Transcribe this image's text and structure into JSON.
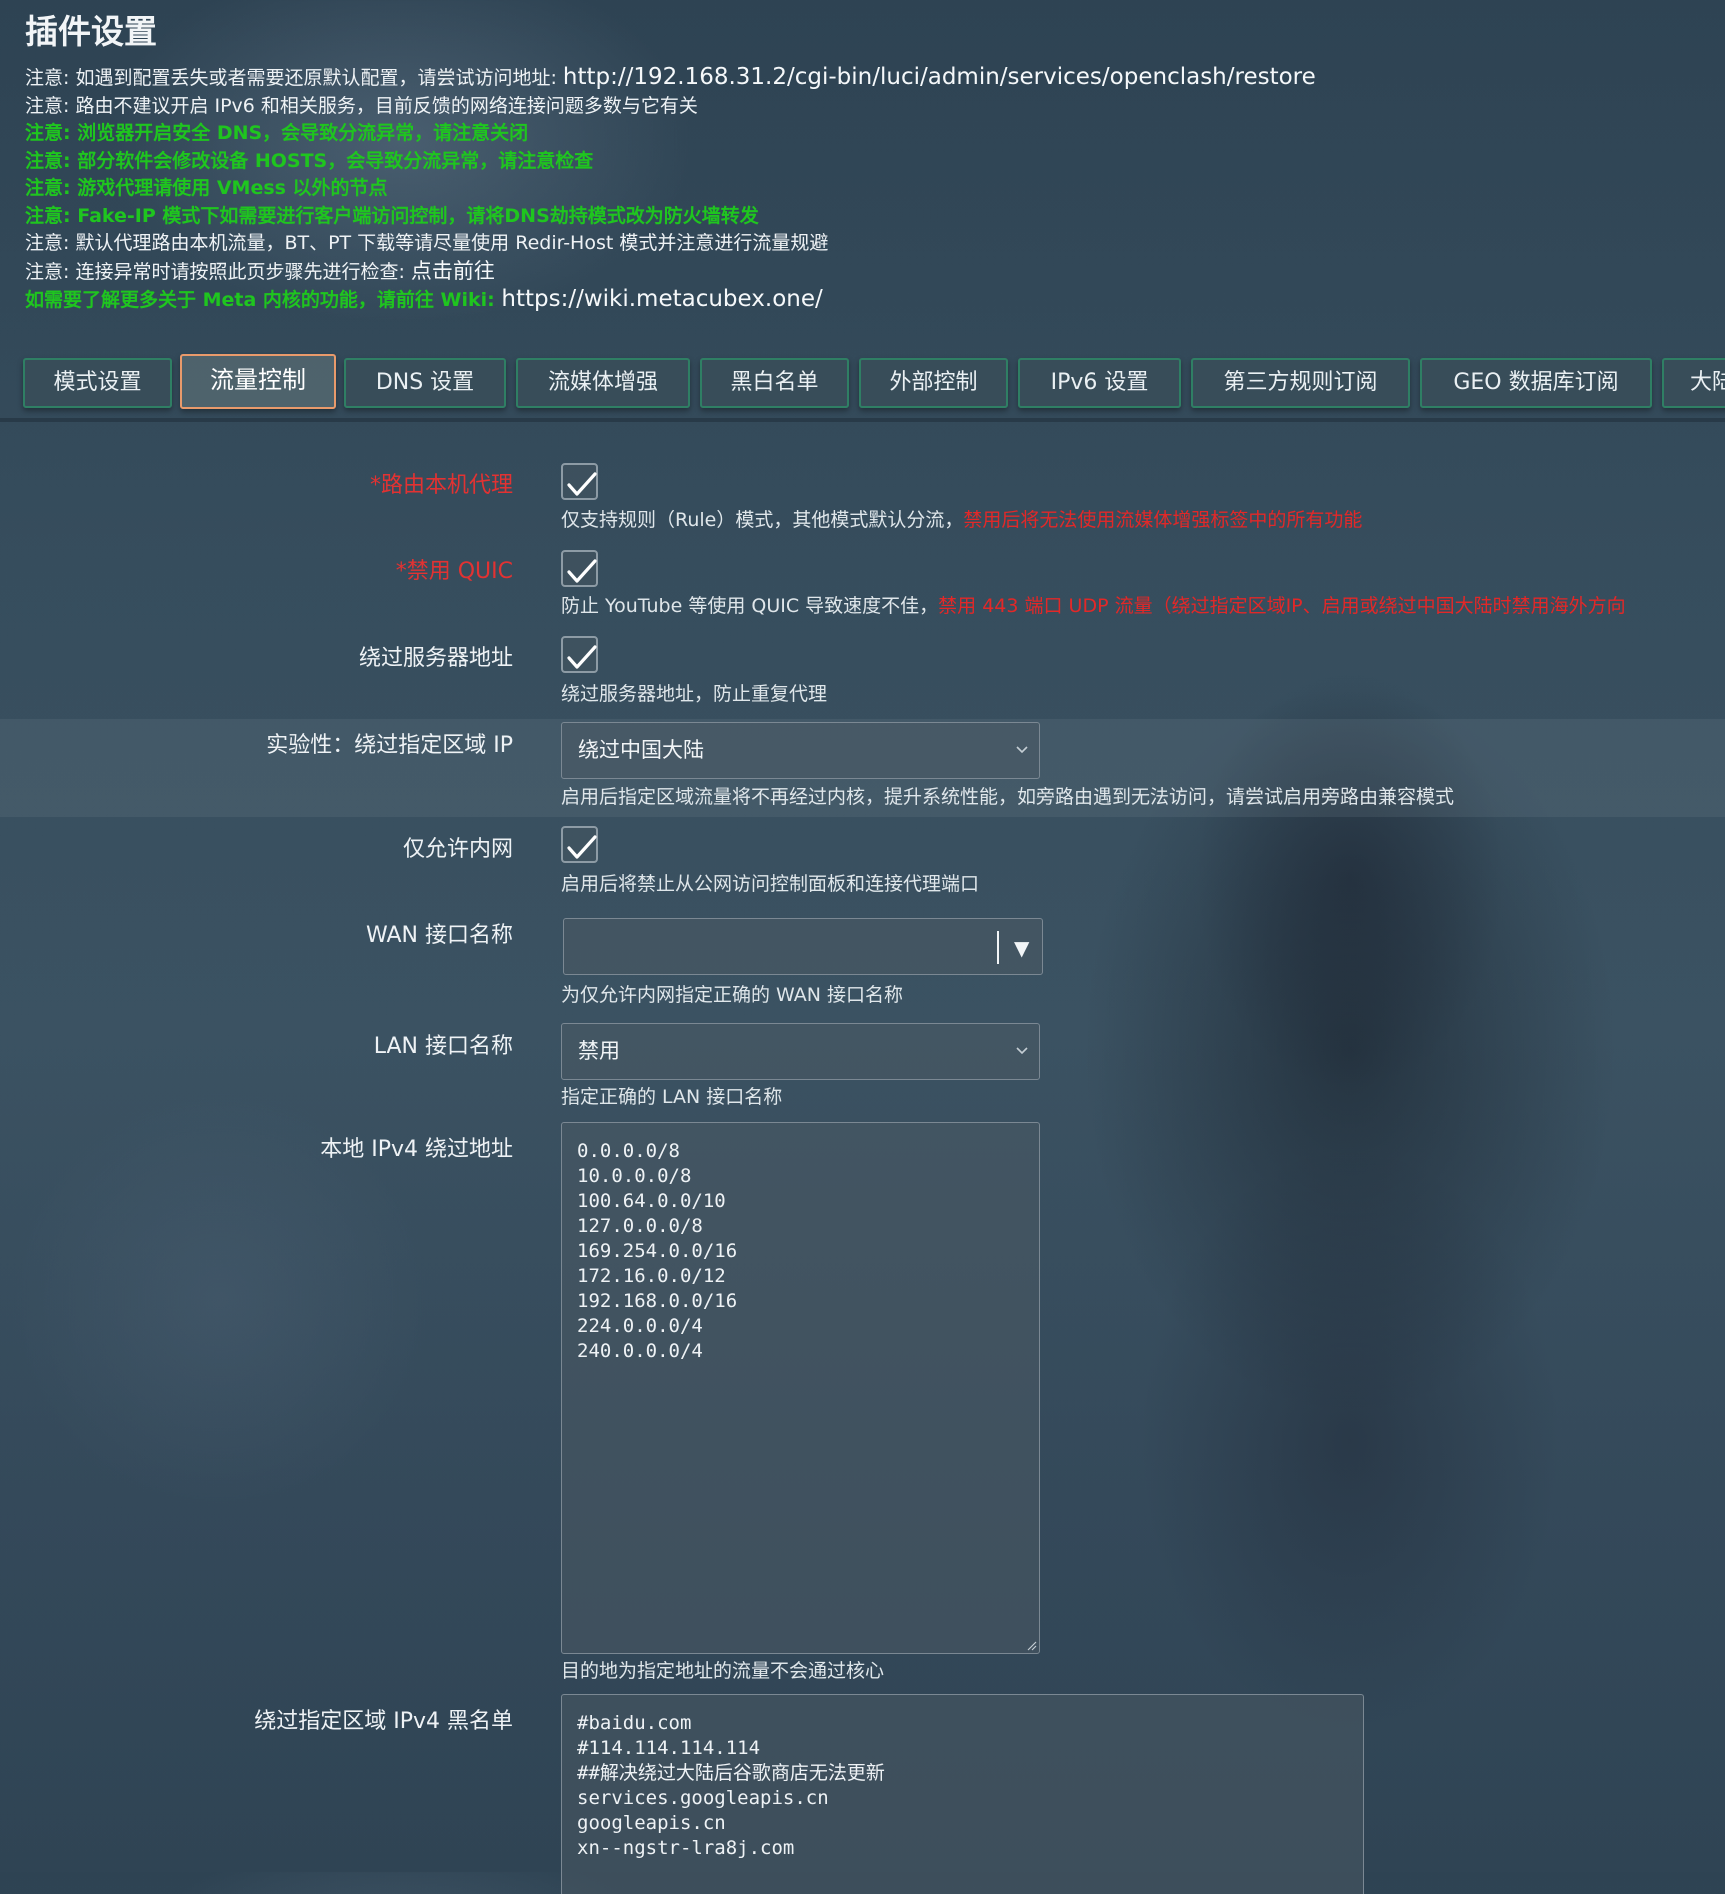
{
  "page": {
    "title": "插件设置"
  },
  "notes": [
    {
      "prefix": "注意: 如遇到配置丢失或者需要还原默认配置，请尝试访问地址: ",
      "url": "http://192.168.31.2/cgi-bin/luci/admin/services/openclash/restore",
      "style": "normal"
    },
    {
      "text": "注意: 路由不建议开启 IPv6 和相关服务，目前反馈的网络连接问题多数与它有关",
      "style": "normal"
    },
    {
      "text": "注意: 浏览器开启安全 DNS，会导致分流异常，请注意关闭",
      "style": "green"
    },
    {
      "text": "注意: 部分软件会修改设备 HOSTS，会导致分流异常，请注意检查",
      "style": "green"
    },
    {
      "text": "注意: 游戏代理请使用 VMess 以外的节点",
      "style": "green"
    },
    {
      "text": "注意: Fake-IP 模式下如需要进行客户端访问控制，请将DNS劫持模式改为防火墙转发",
      "style": "green"
    },
    {
      "text": "注意: 默认代理路由本机流量，BT、PT 下载等请尽量使用 Redir-Host 模式并注意进行流量规避",
      "style": "normal"
    },
    {
      "prefix": "注意: 连接异常时请按照此页步骤先进行检查: ",
      "link": "点击前往",
      "style": "normal"
    },
    {
      "prefix": "如需要了解更多关于 Meta 内核的功能，请前往 Wiki: ",
      "url": "https://wiki.metacubex.one/",
      "style": "green"
    }
  ],
  "tabs": [
    {
      "label": "模式设置",
      "active": false
    },
    {
      "label": "流量控制",
      "active": true
    },
    {
      "label": "DNS 设置",
      "active": false
    },
    {
      "label": "流媒体增强",
      "active": false
    },
    {
      "label": "黑白名单",
      "active": false
    },
    {
      "label": "外部控制",
      "active": false
    },
    {
      "label": "IPv6 设置",
      "active": false
    },
    {
      "label": "第三方规则订阅",
      "active": false
    },
    {
      "label": "GEO 数据库订阅",
      "active": false
    },
    {
      "label": "大陆",
      "active": false
    }
  ],
  "form": {
    "router_self_proxy": {
      "label": "*路由本机代理",
      "checked": true,
      "desc": "仅支持规则（Rule）模式，其他模式默认分流，",
      "desc_warn": "禁用后将无法使用流媒体增强标签中的所有功能"
    },
    "disable_quic": {
      "label": "*禁用 QUIC",
      "checked": true,
      "desc": "防止 YouTube 等使用 QUIC 导致速度不佳，",
      "desc_warn": "禁用 443 端口 UDP 流量（绕过指定区域IP、启用或绕过中国大陆时禁用海外方向"
    },
    "bypass_server_addr": {
      "label": "绕过服务器地址",
      "checked": true,
      "desc": "绕过服务器地址，防止重复代理"
    },
    "bypass_region_ip": {
      "label": "实验性：绕过指定区域 IP",
      "value": "绕过中国大陆",
      "desc": "启用后指定区域流量将不再经过内核，提升系统性能，如旁路由遇到无法访问，请尝试启用旁路由兼容模式"
    },
    "lan_only": {
      "label": "仅允许内网",
      "checked": true,
      "desc": "启用后将禁止从公网访问控制面板和连接代理端口"
    },
    "wan_iface": {
      "label": "WAN 接口名称",
      "value": "",
      "desc": "为仅允许内网指定正确的 WAN 接口名称"
    },
    "lan_iface": {
      "label": "LAN 接口名称",
      "value": "禁用",
      "desc": "指定正确的 LAN 接口名称"
    },
    "local_ipv4_bypass": {
      "label": "本地 IPv4 绕过地址",
      "lines": [
        "0.0.0.0/8",
        "10.0.0.0/8",
        "100.64.0.0/10",
        "127.0.0.0/8",
        "169.254.0.0/16",
        "172.16.0.0/12",
        "192.168.0.0/16",
        "224.0.0.0/4",
        "240.0.0.0/4"
      ],
      "desc": "目的地为指定地址的流量不会通过核心"
    },
    "region_ipv4_blacklist": {
      "label": "绕过指定区域 IPv4 黑名单",
      "lines": [
        "#baidu.com",
        "#114.114.114.114",
        "##解决绕过大陆后谷歌商店无法更新",
        "services.googleapis.cn",
        "googleapis.cn",
        "xn--ngstr-lra8j.com"
      ]
    }
  },
  "colors": {
    "required_label": "#e23232",
    "note_green": "#1fc51f",
    "tab_border": "#2f7f64",
    "tab_active_border": "#e99a6b",
    "warn_text": "#e22828"
  }
}
